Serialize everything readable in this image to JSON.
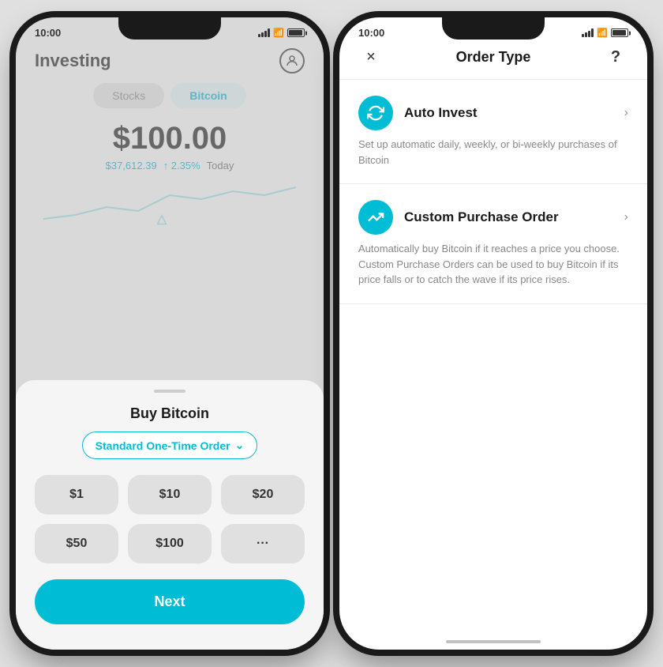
{
  "leftPhone": {
    "statusBar": {
      "time": "10:00"
    },
    "header": {
      "title": "Investing",
      "profileIcon": "person"
    },
    "tabs": [
      {
        "label": "Stocks",
        "active": false
      },
      {
        "label": "Bitcoin",
        "active": true
      }
    ],
    "price": {
      "main": "$100.00",
      "btcPrice": "$37,612.39",
      "change": "↑ 2.35%",
      "period": "Today"
    },
    "bottomSheet": {
      "title": "Buy Bitcoin",
      "orderTypeLabel": "Standard One-Time Order",
      "amounts": [
        "$1",
        "$10",
        "$20",
        "$50",
        "$100",
        "···"
      ],
      "nextButton": "Next"
    }
  },
  "rightPhone": {
    "statusBar": {
      "time": "10:00"
    },
    "header": {
      "title": "Order Type",
      "closeLabel": "×",
      "helpLabel": "?"
    },
    "options": [
      {
        "id": "auto-invest",
        "icon": "↺",
        "label": "Auto Invest",
        "description": "Set up automatic daily, weekly, or bi-weekly purchases of Bitcoin"
      },
      {
        "id": "custom-purchase",
        "icon": "⤢",
        "label": "Custom Purchase Order",
        "description": "Automatically buy Bitcoin if it reaches a price you choose. Custom Purchase Orders can be used to buy Bitcoin if its price falls or to catch the wave if its price rises."
      }
    ]
  }
}
